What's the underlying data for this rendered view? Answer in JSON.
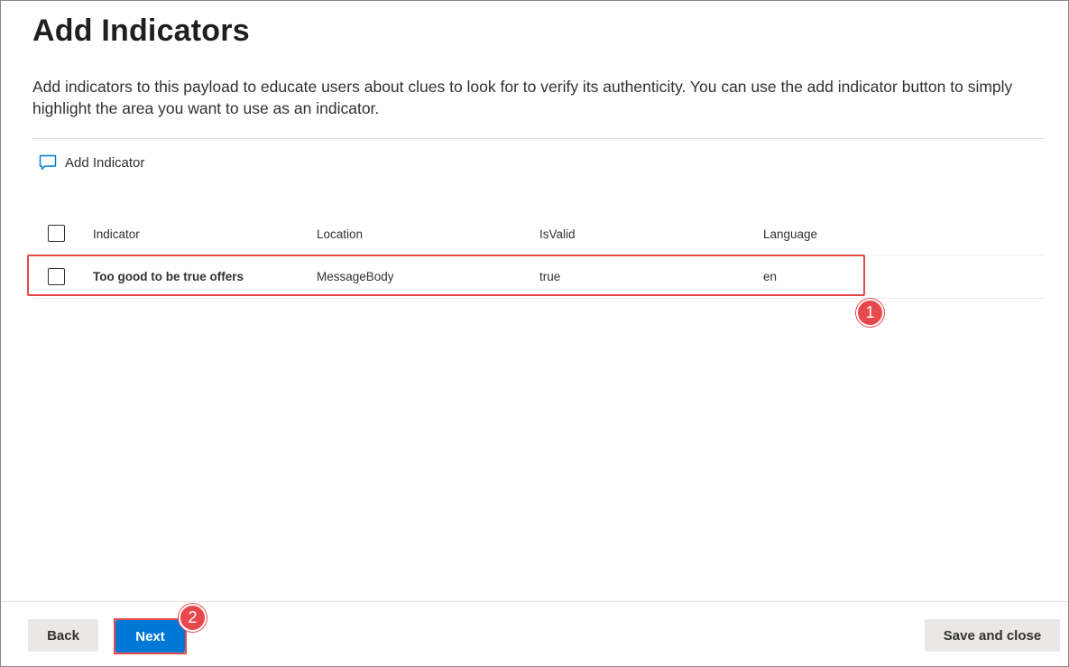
{
  "page": {
    "title": "Add Indicators",
    "description": "Add indicators to this payload to educate users about clues to look for to verify its authenticity. You can use the add indicator button to simply highlight the area you want to use as an indicator."
  },
  "command_bar": {
    "add_indicator_label": "Add Indicator",
    "add_indicator_icon": "comment-icon"
  },
  "table": {
    "columns": [
      "Indicator",
      "Location",
      "IsValid",
      "Language"
    ],
    "rows": [
      {
        "indicator": "Too good to be true offers",
        "location": "MessageBody",
        "is_valid": "true",
        "language": "en"
      }
    ]
  },
  "annotations": {
    "badge1": "1",
    "badge2": "2",
    "highlight_color": "#e8474c"
  },
  "footer": {
    "back_label": "Back",
    "next_label": "Next",
    "save_close_label": "Save and close"
  },
  "colors": {
    "accent": "#0078d4",
    "secondary_button": "#e9e8e7"
  }
}
